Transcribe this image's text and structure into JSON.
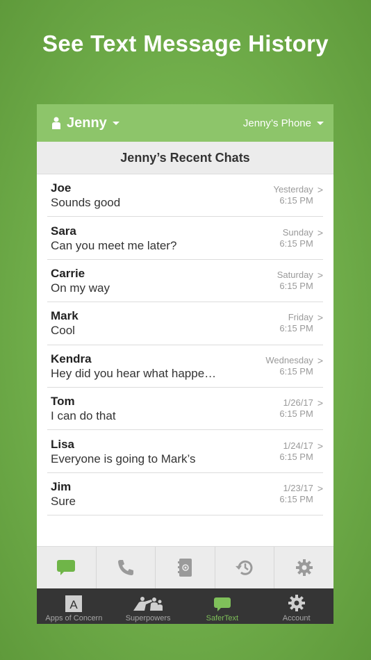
{
  "headline": "See Text Message History",
  "colors": {
    "accent": "#8dc56a",
    "active_tab": "#7fc05a",
    "tabbar_bg": "#353535"
  },
  "topbar": {
    "user_name": "Jenny",
    "device_name": "Jenny’s Phone",
    "user_icon": "person-icon"
  },
  "section_title": "Jenny’s Recent Chats",
  "chats": [
    {
      "name": "Joe",
      "message": "Sounds good",
      "day": "Yesterday",
      "time": "6:15 PM"
    },
    {
      "name": "Sara",
      "message": "Can you meet me later?",
      "day": "Sunday",
      "time": "6:15 PM"
    },
    {
      "name": "Carrie",
      "message": "On my way",
      "day": "Saturday",
      "time": "6:15 PM"
    },
    {
      "name": "Mark",
      "message": "Cool",
      "day": "Friday",
      "time": "6:15 PM"
    },
    {
      "name": "Kendra",
      "message": "Hey did you hear what happe…",
      "day": "Wednesday",
      "time": "6:15 PM"
    },
    {
      "name": "Tom",
      "message": "I can do that",
      "day": "1/26/17",
      "time": "6:15 PM"
    },
    {
      "name": "Lisa",
      "message": "Everyone is going to Mark’s",
      "day": "1/24/17",
      "time": "6:15 PM"
    },
    {
      "name": "Jim",
      "message": "Sure",
      "day": "1/23/17",
      "time": "6:15 PM"
    }
  ],
  "chevron": ">",
  "toolbar_icons": [
    "chat-bubble-icon",
    "phone-icon",
    "contacts-icon",
    "history-icon",
    "gear-icon"
  ],
  "tabs": [
    {
      "label": "Apps of Concern",
      "icon": "apps-of-concern-icon",
      "glyph": "A"
    },
    {
      "label": "Superpowers",
      "icon": "superpowers-icon"
    },
    {
      "label": "SaferText",
      "icon": "chat-bubble-icon"
    },
    {
      "label": "Account",
      "icon": "gear-icon"
    }
  ]
}
